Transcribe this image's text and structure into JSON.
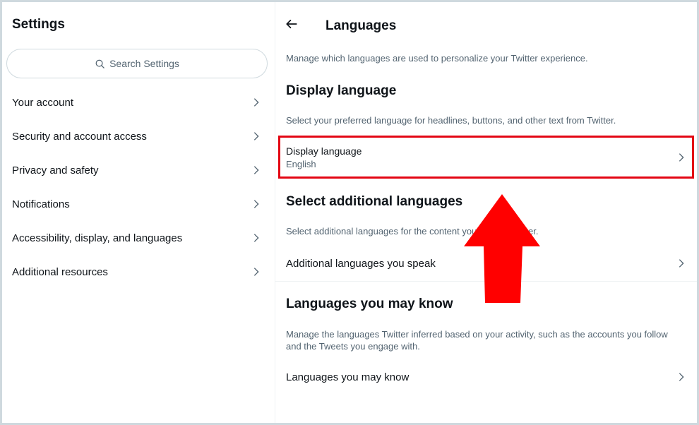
{
  "sidebar": {
    "title": "Settings",
    "search_placeholder": "Search Settings",
    "items": [
      {
        "label": "Your account"
      },
      {
        "label": "Security and account access"
      },
      {
        "label": "Privacy and safety"
      },
      {
        "label": "Notifications"
      },
      {
        "label": "Accessibility, display, and languages"
      },
      {
        "label": "Additional resources"
      }
    ]
  },
  "main": {
    "title": "Languages",
    "intro": "Manage which languages are used to personalize your Twitter experience.",
    "display": {
      "heading": "Display language",
      "description": "Select your preferred language for headlines, buttons, and other text from Twitter.",
      "row_label": "Display language",
      "row_value": "English"
    },
    "additional": {
      "heading": "Select additional languages",
      "description": "Select additional languages for the content you see on Twitter.",
      "row_label": "Additional languages you speak"
    },
    "may_know": {
      "heading": "Languages you may know",
      "description_line1": "Manage the languages Twitter inferred based on your activity, such as the accounts you follow",
      "description_line2": "and the Tweets you engage with.",
      "row_label": "Languages you may know"
    }
  },
  "colors": {
    "highlight": "#e30613",
    "arrow": "#ff0000"
  }
}
